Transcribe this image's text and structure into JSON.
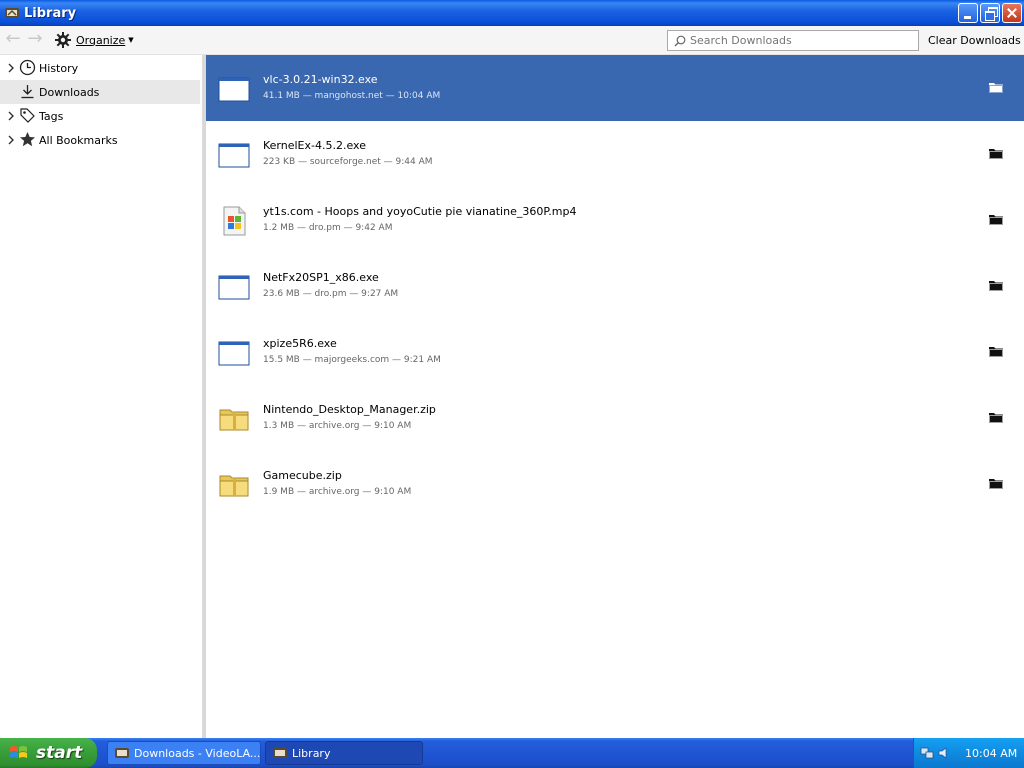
{
  "window": {
    "title": "Library",
    "minimize_icon": "minimize-icon",
    "maximize_icon": "restore-icon",
    "close_icon": "close-icon"
  },
  "toolbar": {
    "organize_label": "Organize",
    "search_placeholder": "Search Downloads",
    "clear_label": "Clear Downloads"
  },
  "sidebar": {
    "items": [
      {
        "label": "History",
        "icon": "clock-icon",
        "expandable": true,
        "selected": false
      },
      {
        "label": "Downloads",
        "icon": "download-arrow-icon",
        "expandable": false,
        "selected": true
      },
      {
        "label": "Tags",
        "icon": "tag-icon",
        "expandable": true,
        "selected": false
      },
      {
        "label": "All Bookmarks",
        "icon": "star-icon",
        "expandable": true,
        "selected": false
      }
    ]
  },
  "downloads": [
    {
      "name": "vlc-3.0.21-win32.exe",
      "meta": "41.1 MB — mangohost.net — 10:04 AM",
      "icon": "exe-window-icon",
      "selected": true
    },
    {
      "name": "KernelEx-4.5.2.exe",
      "meta": "223 KB — sourceforge.net — 9:44 AM",
      "icon": "exe-window-icon",
      "selected": false
    },
    {
      "name": "yt1s.com - Hoops and yoyoCutie pie vianatine_360P.mp4",
      "meta": "1.2 MB — dro.pm — 9:42 AM",
      "icon": "media-file-icon",
      "selected": false
    },
    {
      "name": "NetFx20SP1_x86.exe",
      "meta": "23.6 MB — dro.pm — 9:27 AM",
      "icon": "exe-window-icon",
      "selected": false
    },
    {
      "name": "xpize5R6.exe",
      "meta": "15.5 MB — majorgeeks.com — 9:21 AM",
      "icon": "exe-window-icon",
      "selected": false
    },
    {
      "name": "Nintendo_Desktop_Manager.zip",
      "meta": "1.3 MB — archive.org — 9:10 AM",
      "icon": "zip-folder-icon",
      "selected": false
    },
    {
      "name": "Gamecube.zip",
      "meta": "1.9 MB — archive.org — 9:10 AM",
      "icon": "zip-folder-icon",
      "selected": false
    }
  ],
  "taskbar": {
    "start_label": "start",
    "tasks": [
      {
        "label": "Downloads - VideoLA...",
        "active": false
      },
      {
        "label": "Library",
        "active": true
      }
    ],
    "clock": "10:04 AM"
  },
  "colors": {
    "selection": "#3a68b0",
    "titlebar": "#0a4fd8",
    "taskbar": "#1f55d2",
    "start": "#3aa13c"
  }
}
